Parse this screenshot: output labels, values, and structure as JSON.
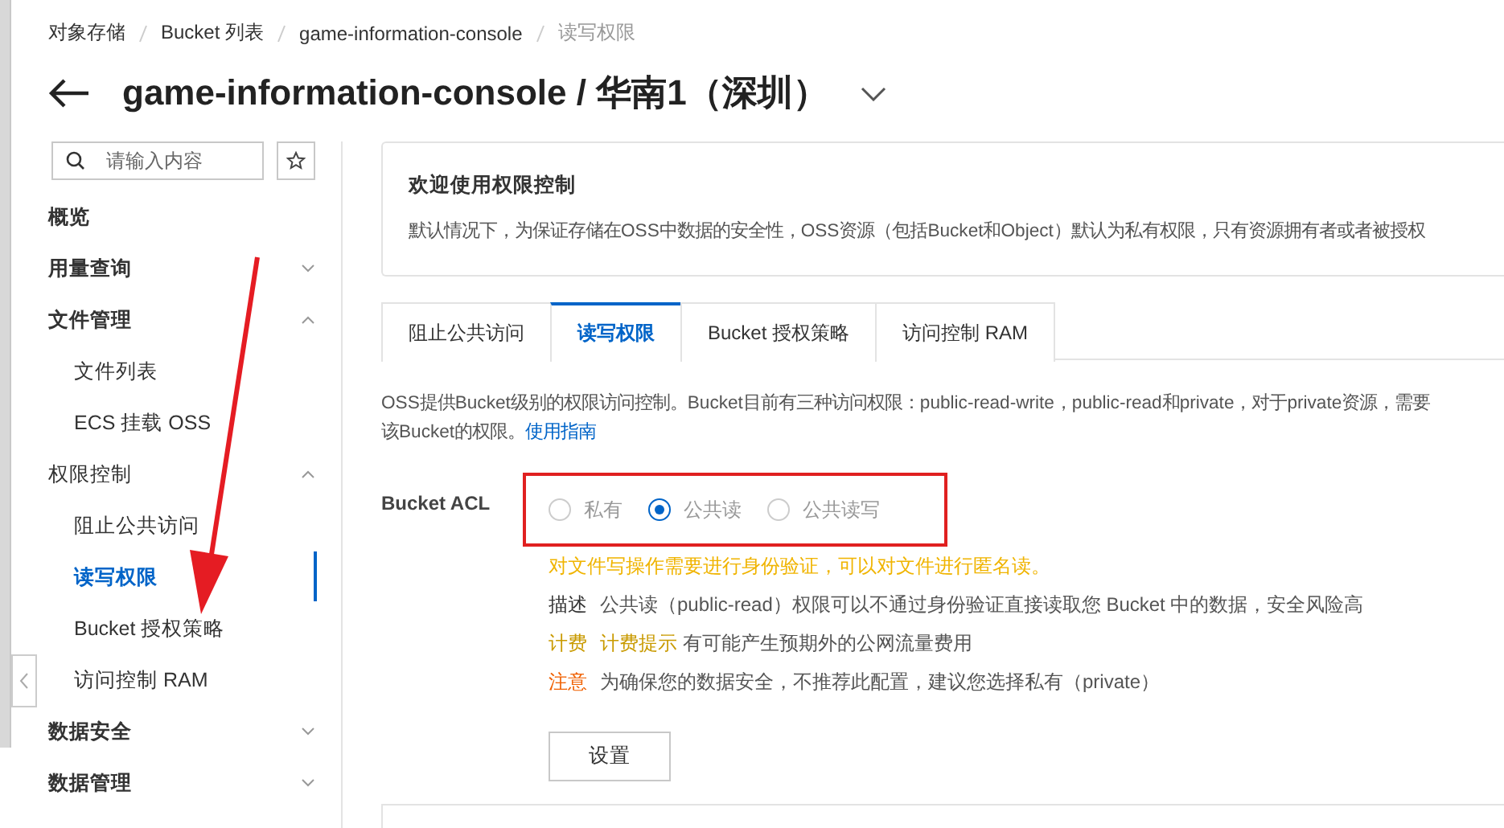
{
  "breadcrumb": [
    {
      "label": "对象存储",
      "current": false
    },
    {
      "label": "Bucket 列表",
      "current": false
    },
    {
      "label": "game-information-console",
      "current": false
    },
    {
      "label": "读写权限",
      "current": true
    }
  ],
  "header": {
    "title": "game-information-console / 华南1（深圳）"
  },
  "sidebar": {
    "search": {
      "placeholder": "请输入内容"
    },
    "items": [
      {
        "label": "概览",
        "bold": true
      },
      {
        "label": "用量查询",
        "bold": true,
        "expanded": false
      },
      {
        "label": "文件管理",
        "bold": true,
        "expanded": true,
        "children": [
          {
            "label": "文件列表",
            "selected": false
          },
          {
            "label": "ECS 挂载 OSS",
            "selected": false
          }
        ]
      },
      {
        "label": "权限控制",
        "bold": false,
        "expanded": true,
        "children": [
          {
            "label": "阻止公共访问",
            "selected": false
          },
          {
            "label": "读写权限",
            "selected": true
          },
          {
            "label": "Bucket 授权策略",
            "selected": false
          },
          {
            "label": "访问控制 RAM",
            "selected": false
          }
        ]
      },
      {
        "label": "数据安全",
        "bold": true,
        "expanded": false
      },
      {
        "label": "数据管理",
        "bold": true,
        "expanded": false
      }
    ]
  },
  "welcome": {
    "title": "欢迎使用权限控制",
    "text": "默认情况下，为保证存储在OSS中数据的安全性，OSS资源（包括Bucket和Object）默认为私有权限，只有资源拥有者或者被授权"
  },
  "tabs": [
    {
      "label": "阻止公共访问",
      "selected": false
    },
    {
      "label": "读写权限",
      "selected": true
    },
    {
      "label": "Bucket 授权策略",
      "selected": false
    },
    {
      "label": "访问控制 RAM",
      "selected": false
    }
  ],
  "intro": {
    "lines": [
      "OSS提供Bucket级别的权限访问控制。Bucket目前有三种访问权限：public-read-write，public-read和private，对于private资源，需要",
      "该Bucket的权限。"
    ],
    "link": "使用指南"
  },
  "acl": {
    "label": "Bucket ACL",
    "options": [
      {
        "label": "私有",
        "selected": false
      },
      {
        "label": "公共读",
        "selected": true
      },
      {
        "label": "公共读写",
        "selected": false
      }
    ],
    "hint": "对文件写操作需要进行身份验证，可以对文件进行匿名读。",
    "notes": [
      {
        "kind": "description",
        "label": "描述",
        "text": "公共读（public-read）权限可以不通过身份验证直接读取您 Bucket 中的数据，安全风险高"
      },
      {
        "kind": "billing",
        "label": "计费",
        "highlight": "计费提示",
        "text": "有可能产生预期外的公网流量费用"
      },
      {
        "kind": "warning",
        "label": "注意",
        "text": "为确保您的数据安全，不推荐此配置，建议您选择私有（private）"
      }
    ],
    "button": "设置"
  }
}
